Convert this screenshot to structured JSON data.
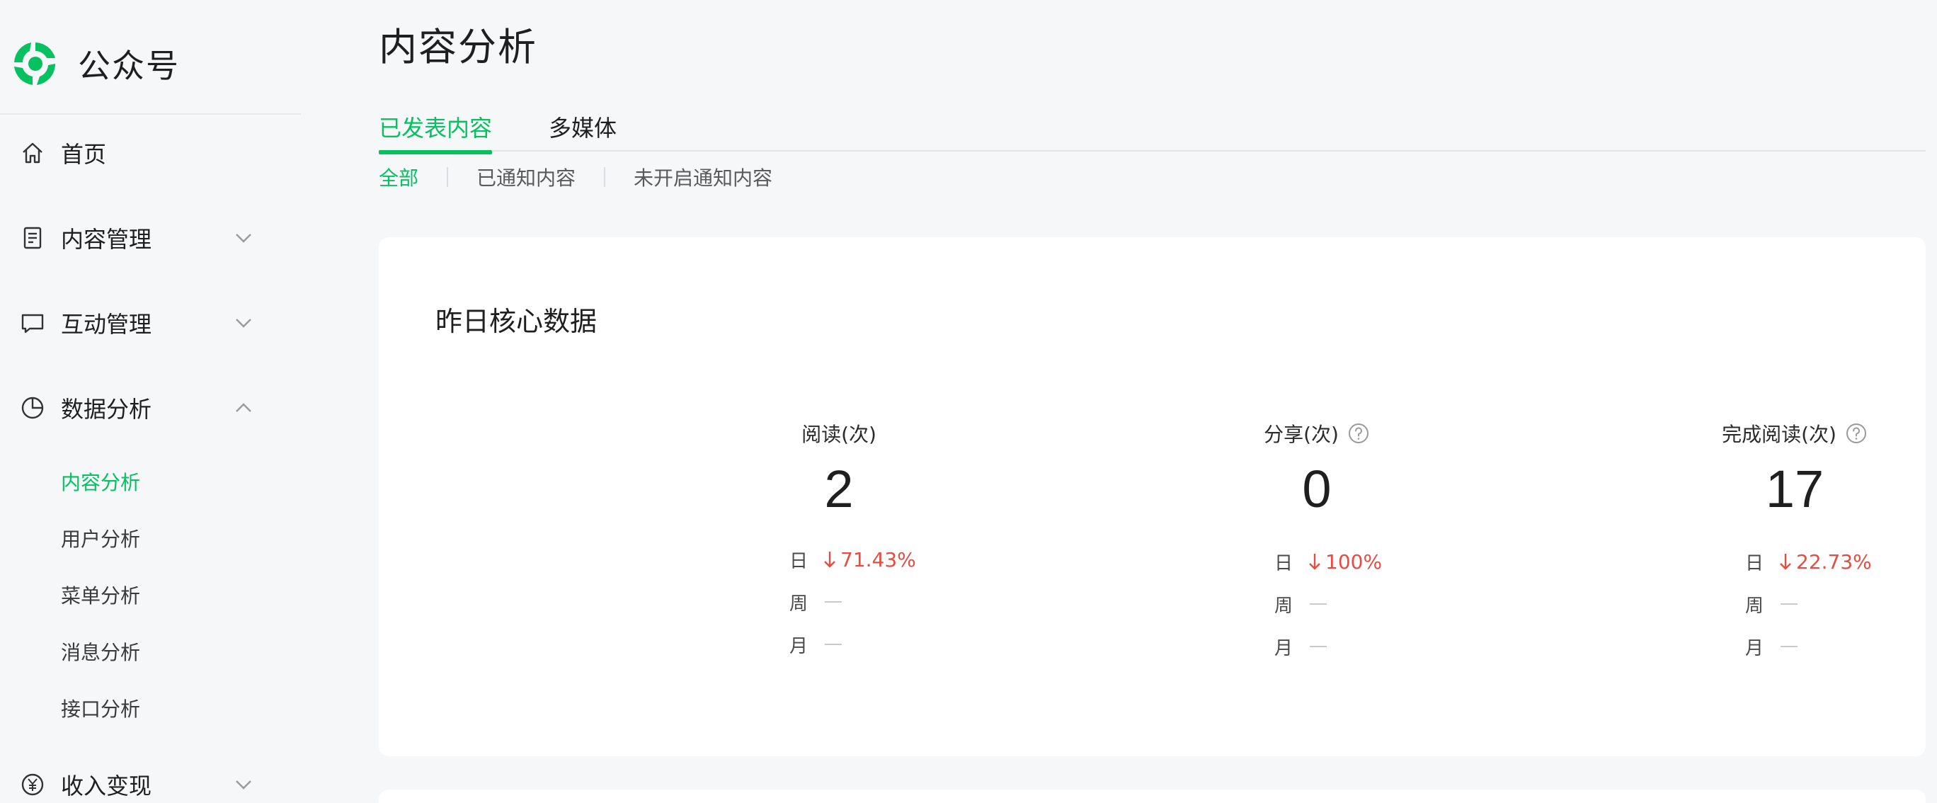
{
  "brand": {
    "name": "公众号",
    "accent": "#07c160"
  },
  "sidebar": {
    "items": [
      {
        "label": "首页",
        "icon": "home-icon"
      },
      {
        "label": "内容管理",
        "icon": "document-icon"
      },
      {
        "label": "互动管理",
        "icon": "chat-bubble-icon"
      },
      {
        "label": "数据分析",
        "icon": "pie-chart-icon"
      },
      {
        "label": "收入变现",
        "icon": "yen-coin-icon"
      }
    ],
    "sub_items": [
      "内容分析",
      "用户分析",
      "菜单分析",
      "消息分析",
      "接口分析"
    ],
    "active_sub": "内容分析"
  },
  "page": {
    "title": "内容分析"
  },
  "tabs": [
    {
      "label": "已发表内容",
      "active": true
    },
    {
      "label": "多媒体",
      "active": false
    }
  ],
  "subtabs": [
    {
      "label": "全部",
      "active": true
    },
    {
      "label": "已通知内容",
      "active": false
    },
    {
      "label": "未开启通知内容",
      "active": false
    }
  ],
  "card": {
    "title": "昨日核心数据",
    "metrics": [
      {
        "label": "阅读(次)",
        "value": "2",
        "day_label": "日",
        "day_change": "71.43%",
        "week_label": "周",
        "month_label": "月",
        "has_help": false
      },
      {
        "label": "分享(次)",
        "value": "0",
        "day_label": "日",
        "day_change": "100%",
        "week_label": "周",
        "month_label": "月",
        "has_help": true
      },
      {
        "label": "完成阅读(次)",
        "value": "17",
        "day_label": "日",
        "day_change": "22.73%",
        "week_label": "周",
        "month_label": "月",
        "has_help": true
      }
    ]
  },
  "colors": {
    "accent": "#07c160",
    "decrease": "#e54d42"
  }
}
